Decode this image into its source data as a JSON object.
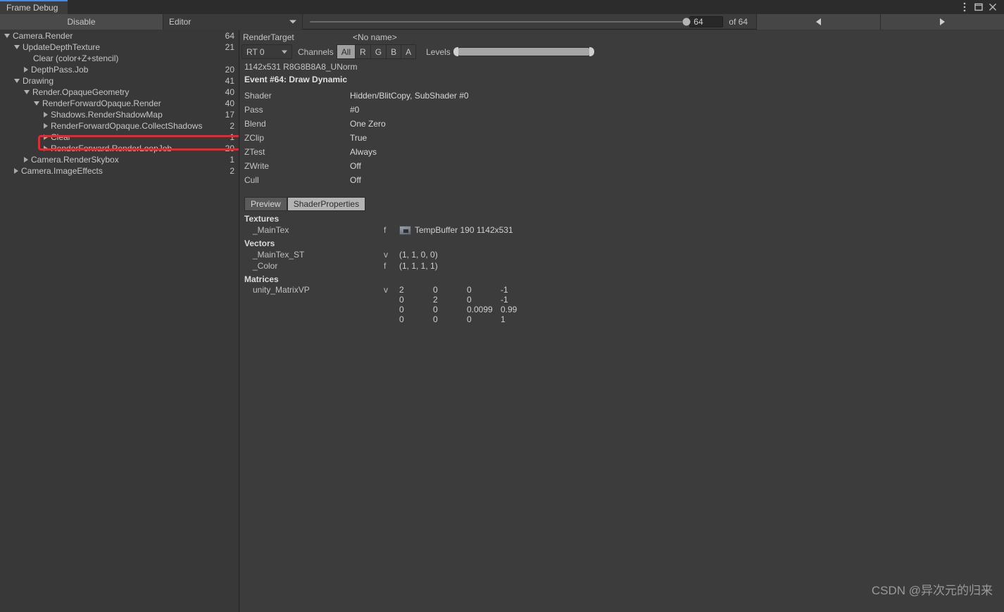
{
  "window": {
    "tab_title": "Frame Debug",
    "controls": {
      "menu": "kebab-menu-icon",
      "maximize": "maximize-icon",
      "close": "close-icon"
    },
    "accent_color": "#4a8cd8"
  },
  "toolbar": {
    "disable_label": "Disable",
    "target_select_value": "Editor",
    "event_slider": {
      "value": 64,
      "max": 64,
      "percent": 100
    },
    "event_number_value": "64",
    "of_count_label": "of 64",
    "prev_label": "prev-event-arrow",
    "next_label": "next-event-arrow"
  },
  "tree": {
    "rows": [
      {
        "label": "Camera.Render",
        "count": "64",
        "indent": 0,
        "arrow": "down",
        "selected": false
      },
      {
        "label": "UpdateDepthTexture",
        "count": "21",
        "indent": 1,
        "arrow": "down",
        "selected": false
      },
      {
        "label": "Clear (color+Z+stencil)",
        "count": "",
        "indent": 2,
        "arrow": "none",
        "selected": false
      },
      {
        "label": "DepthPass.Job",
        "count": "20",
        "indent": 2,
        "arrow": "right",
        "selected": false
      },
      {
        "label": "Drawing",
        "count": "41",
        "indent": 1,
        "arrow": "down",
        "selected": false
      },
      {
        "label": "Render.OpaqueGeometry",
        "count": "40",
        "indent": 2,
        "arrow": "down",
        "selected": false
      },
      {
        "label": "RenderForwardOpaque.Render",
        "count": "40",
        "indent": 3,
        "arrow": "down",
        "selected": false
      },
      {
        "label": "Shadows.RenderShadowMap",
        "count": "17",
        "indent": 4,
        "arrow": "right",
        "selected": true
      },
      {
        "label": "RenderForwardOpaque.CollectShadows",
        "count": "2",
        "indent": 4,
        "arrow": "right",
        "selected": false
      },
      {
        "label": "Clear",
        "count": "1",
        "indent": 4,
        "arrow": "right",
        "selected": false
      },
      {
        "label": "RenderForward.RenderLoopJob",
        "count": "20",
        "indent": 4,
        "arrow": "right",
        "selected": false
      },
      {
        "label": "Camera.RenderSkybox",
        "count": "1",
        "indent": 2,
        "arrow": "right",
        "selected": false
      },
      {
        "label": "Camera.ImageEffects",
        "count": "2",
        "indent": 1,
        "arrow": "right",
        "selected": false
      }
    ],
    "highlight_color": "#f5222d"
  },
  "detail": {
    "render_target_label": "RenderTarget",
    "render_target_name": "<No name>",
    "rt_dropdown_value": "RT 0",
    "channels_label": "Channels",
    "channel_buttons": [
      {
        "label": "All",
        "selected": true
      },
      {
        "label": "R",
        "selected": false
      },
      {
        "label": "G",
        "selected": false
      },
      {
        "label": "B",
        "selected": false
      },
      {
        "label": "A",
        "selected": false
      }
    ],
    "levels_label": "Levels",
    "rt_info": "1142x531 R8G8B8A8_UNorm",
    "event_title": "Event #64: Draw Dynamic",
    "properties": [
      {
        "key": "Shader",
        "value": "Hidden/BlitCopy, SubShader #0"
      },
      {
        "key": "Pass",
        "value": "#0"
      },
      {
        "key": "Blend",
        "value": "One Zero"
      },
      {
        "key": "ZClip",
        "value": "True"
      },
      {
        "key": "ZTest",
        "value": "Always"
      },
      {
        "key": "ZWrite",
        "value": "Off"
      },
      {
        "key": "Cull",
        "value": "Off"
      }
    ],
    "view_tabs": [
      {
        "label": "Preview",
        "selected": false
      },
      {
        "label": "ShaderProperties",
        "selected": true
      }
    ],
    "textures_title": "Textures",
    "textures": [
      {
        "name": "_MainTex",
        "type": "f",
        "value": "TempBuffer 190 1142x531"
      }
    ],
    "vectors_title": "Vectors",
    "vectors": [
      {
        "name": "_MainTex_ST",
        "type": "v",
        "value": "(1, 1, 0, 0)"
      },
      {
        "name": "_Color",
        "type": "f",
        "value": "(1, 1, 1, 1)"
      }
    ],
    "matrices_title": "Matrices",
    "matrices": [
      {
        "name": "unity_MatrixVP",
        "type": "v",
        "rows": [
          [
            "2",
            "0",
            "0",
            "-1"
          ],
          [
            "0",
            "2",
            "0",
            "-1"
          ],
          [
            "0",
            "0",
            "0.0099",
            "0.99"
          ],
          [
            "0",
            "0",
            "0",
            "1"
          ]
        ]
      }
    ]
  },
  "watermark": {
    "text": "CSDN @异次元的归来"
  }
}
